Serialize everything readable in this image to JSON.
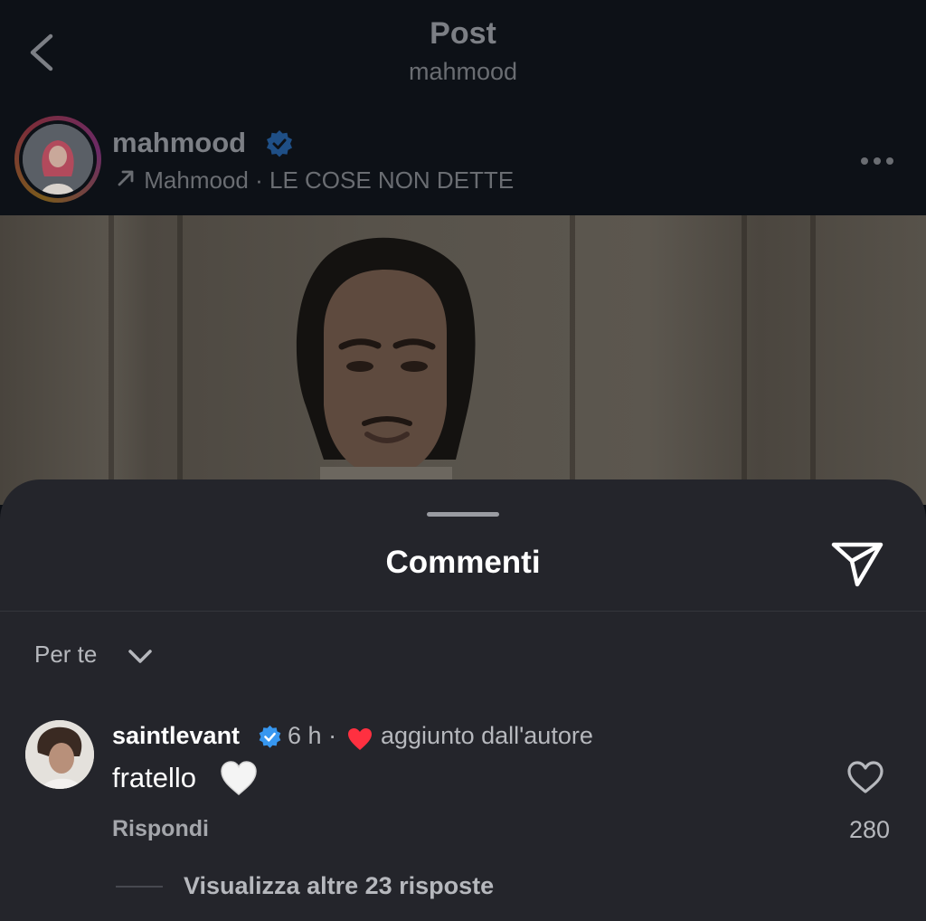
{
  "header": {
    "title": "Post",
    "subtitle": "mahmood"
  },
  "post": {
    "author": "mahmood",
    "verified": true,
    "music_artist": "Mahmood",
    "music_separator": "·",
    "music_track": "LE COSE NON DETTE"
  },
  "comments_sheet": {
    "title": "Commenti",
    "sort_label": "Per te",
    "comment": {
      "username": "saintlevant",
      "verified": true,
      "time": "6 h",
      "separator": "·",
      "author_note": "aggiunto dall'autore",
      "text": "fratello",
      "emoji": "🤍",
      "reply_label": "Rispondi",
      "like_count": "280",
      "view_replies": "Visualizza altre 23 risposte"
    }
  },
  "icons": {
    "back": "chevron-left-icon",
    "verified": "verified-badge-icon",
    "music": "music-arrow-icon",
    "more": "more-horizontal-icon",
    "share": "paper-plane-icon",
    "sort": "chevron-down-icon",
    "author_like": "heart-filled-icon",
    "like": "heart-outline-icon"
  },
  "colors": {
    "verified_blue": "#3797f0",
    "heart_red": "#ff3040",
    "sheet_bg": "#24252b"
  }
}
